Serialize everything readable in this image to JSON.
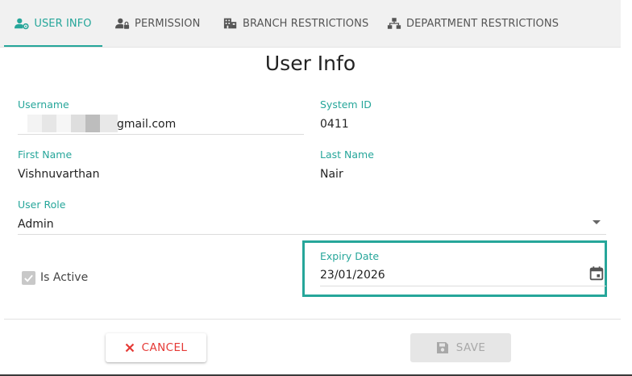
{
  "tabs": [
    {
      "label": "USER INFO",
      "icon": "user-gear-icon",
      "active": true
    },
    {
      "label": "PERMISSION",
      "icon": "user-lock-icon",
      "active": false
    },
    {
      "label": "BRANCH RESTRICTIONS",
      "icon": "building-icon",
      "active": false
    },
    {
      "label": "DEPARTMENT RESTRICTIONS",
      "icon": "sitemap-icon",
      "active": false
    }
  ],
  "title": "User Info",
  "form": {
    "username": {
      "label": "Username",
      "value": "gmail.com"
    },
    "system_id": {
      "label": "System ID",
      "value": "0411"
    },
    "first_name": {
      "label": "First Name",
      "value": "Vishnuvarthan"
    },
    "last_name": {
      "label": "Last Name",
      "value": "Nair"
    },
    "user_role": {
      "label": "User Role",
      "value": "Admin"
    },
    "is_active": {
      "label": "Is Active",
      "checked": true
    },
    "expiry_date": {
      "label": "Expiry Date",
      "value": "23/01/2026"
    }
  },
  "actions": {
    "cancel_label": "CANCEL",
    "save_label": "SAVE"
  },
  "colors": {
    "accent": "#26a69a",
    "cancel": "#e53935"
  }
}
